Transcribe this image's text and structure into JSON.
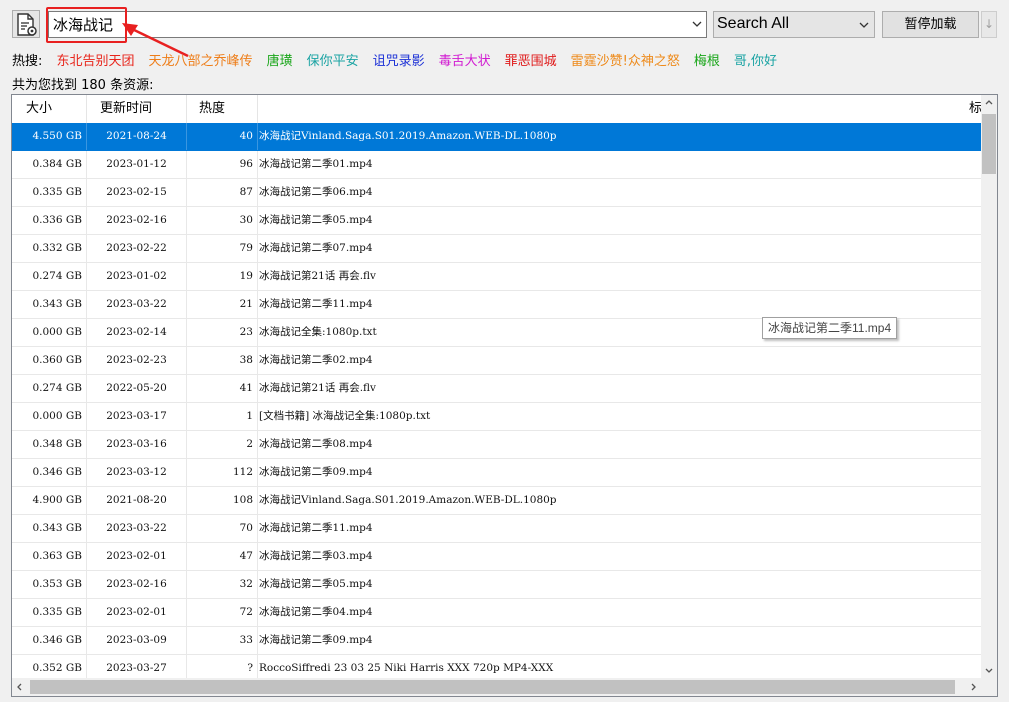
{
  "toolbar": {
    "search_value": "冰海战记",
    "scope_value": "Search All",
    "pause_label": "暂停加载",
    "down_glyph": "↓"
  },
  "hot": {
    "label": "热搜:",
    "items": [
      {
        "text": "东北告别天团",
        "color": "#e8251b"
      },
      {
        "text": "天龙八部之乔峰传",
        "color": "#ee7d18"
      },
      {
        "text": "唐璜",
        "color": "#1aa61a"
      },
      {
        "text": "保你平安",
        "color": "#1aa3a3"
      },
      {
        "text": "诅咒录影",
        "color": "#1a2fd6"
      },
      {
        "text": "毒舌大状",
        "color": "#d11ad1"
      },
      {
        "text": "罪恶围城",
        "color": "#e01a1a"
      },
      {
        "text": "雷霆沙赞!众神之怒",
        "color": "#ee8a1a"
      },
      {
        "text": "梅根",
        "color": "#1aa61a"
      },
      {
        "text": "哥,你好",
        "color": "#1aa3a3"
      }
    ]
  },
  "count_text": "共为您找到 180 条资源:",
  "table": {
    "headers": [
      "大小",
      "更新时间",
      "热度",
      "标"
    ],
    "rows": [
      [
        "4.550 GB",
        "2021-08-24",
        "40",
        "冰海战记Vinland.Saga.S01.2019.Amazon.WEB-DL.1080p"
      ],
      [
        "0.384 GB",
        "2023-01-12",
        "96",
        "冰海战记第二季01.mp4"
      ],
      [
        "0.335 GB",
        "2023-02-15",
        "87",
        "冰海战记第二季06.mp4"
      ],
      [
        "0.336 GB",
        "2023-02-16",
        "30",
        "冰海战记第二季05.mp4"
      ],
      [
        "0.332 GB",
        "2023-02-22",
        "79",
        "冰海战记第二季07.mp4"
      ],
      [
        "0.274 GB",
        "2023-01-02",
        "19",
        "冰海战记第21话 再会.flv"
      ],
      [
        "0.343 GB",
        "2023-03-22",
        "21",
        "冰海战记第二季11.mp4"
      ],
      [
        "0.000 GB",
        "2023-02-14",
        "23",
        "冰海战记全集:1080p.txt"
      ],
      [
        "0.360 GB",
        "2023-02-23",
        "38",
        "冰海战记第二季02.mp4"
      ],
      [
        "0.274 GB",
        "2022-05-20",
        "41",
        "冰海战记第21话 再会.flv"
      ],
      [
        "0.000 GB",
        "2023-03-17",
        "1",
        "[文档书籍] 冰海战记全集:1080p.txt"
      ],
      [
        "0.348 GB",
        "2023-03-16",
        "2",
        "冰海战记第二季08.mp4"
      ],
      [
        "0.346 GB",
        "2023-03-12",
        "112",
        "冰海战记第二季09.mp4"
      ],
      [
        "4.900 GB",
        "2021-08-20",
        "108",
        "冰海战记Vinland.Saga.S01.2019.Amazon.WEB-DL.1080p"
      ],
      [
        "0.343 GB",
        "2023-03-22",
        "70",
        "冰海战记第二季11.mp4"
      ],
      [
        "0.363 GB",
        "2023-02-01",
        "47",
        "冰海战记第二季03.mp4"
      ],
      [
        "0.353 GB",
        "2023-02-16",
        "32",
        "冰海战记第二季05.mp4"
      ],
      [
        "0.335 GB",
        "2023-02-01",
        "72",
        "冰海战记第二季04.mp4"
      ],
      [
        "0.346 GB",
        "2023-03-09",
        "33",
        "冰海战记第二季09.mp4"
      ],
      [
        "0.352 GB",
        "2023-03-27",
        "?",
        "RoccoSiffredi 23 03 25 Niki Harris XXX 720p MP4-XXX"
      ]
    ],
    "selected_row": 0
  },
  "tooltip": "冰海战记第二季11.mp4",
  "colors": {
    "selection": "#0078d7",
    "highlight_box": "#e82020"
  }
}
